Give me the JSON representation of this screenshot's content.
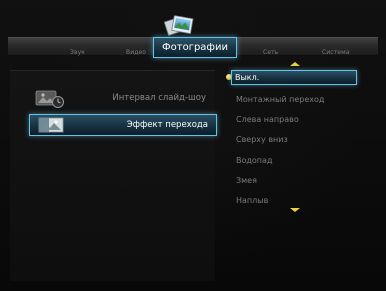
{
  "tabs": {
    "items": [
      {
        "label": "Звук"
      },
      {
        "label": "Видео"
      },
      {
        "label": "Фотографии"
      },
      {
        "label": "Сеть"
      },
      {
        "label": "Система"
      }
    ],
    "active_index": 2
  },
  "left_menu": {
    "items": [
      {
        "label": "Интервал слайд-шоу",
        "icon": "slideshow-timer-icon",
        "selected": false
      },
      {
        "label": "Эффект перехода",
        "icon": "transition-effect-icon",
        "selected": true
      }
    ]
  },
  "options": {
    "items": [
      {
        "label": "Выкл.",
        "selected": true
      },
      {
        "label": "Монтажный переход",
        "selected": false
      },
      {
        "label": "Слева направо",
        "selected": false
      },
      {
        "label": "Сверху вниз",
        "selected": false
      },
      {
        "label": "Водопад",
        "selected": false
      },
      {
        "label": "Змея",
        "selected": false
      },
      {
        "label": "Наплыв",
        "selected": false
      }
    ]
  },
  "colors": {
    "accent": "#5fc4ea",
    "highlight_fill": "#173241",
    "arrow": "#e7d53a",
    "text_active": "#ffffff",
    "text_inactive": "#7b7b7b",
    "background": "#0c0c0c"
  }
}
